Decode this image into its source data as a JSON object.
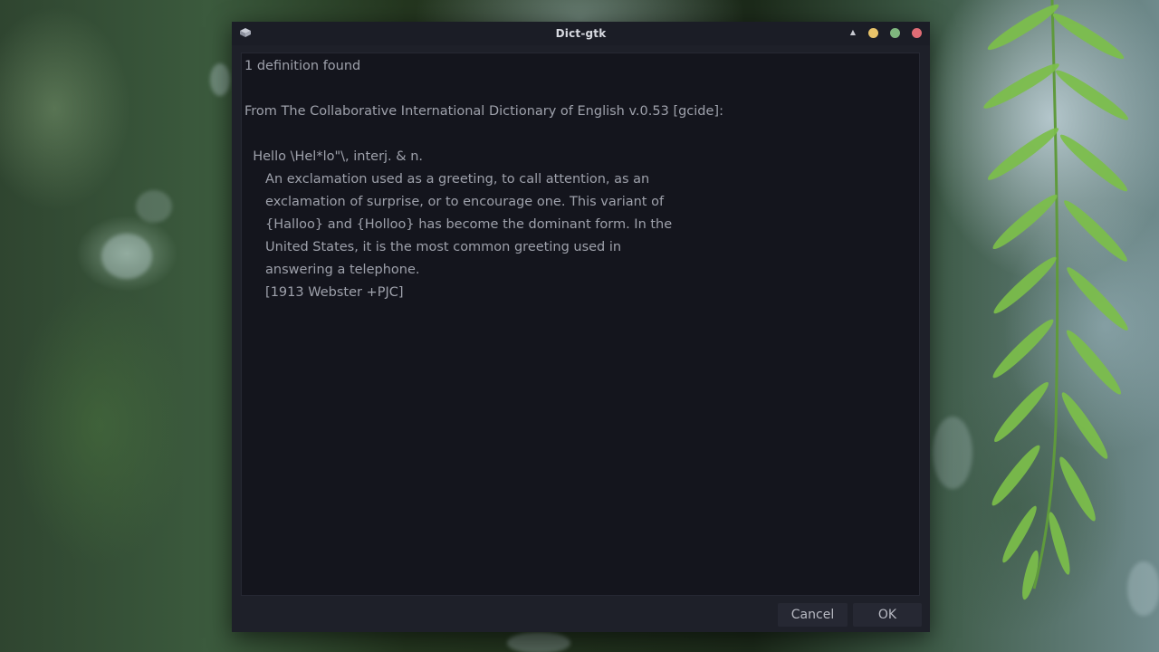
{
  "window": {
    "title": "Dict-gtk"
  },
  "titlebar": {
    "app_icon": "dictionary-icon",
    "shade_icon": "triangle-up-icon",
    "buttons": {
      "minimize_color": "#e9c46a",
      "maximize_color": "#7fb77e",
      "close_color": "#e06c75"
    }
  },
  "definition": {
    "lines": [
      "1 definition found",
      "",
      "From The Collaborative International Dictionary of English v.0.53 [gcide]:",
      "",
      "  Hello \\Hel*lo\"\\, interj. & n.",
      "     An exclamation used as a greeting, to call attention, as an",
      "     exclamation of surprise, or to encourage one. This variant of",
      "     {Halloo} and {Holloo} has become the dominant form. In the",
      "     United States, it is the most common greeting used in",
      "     answering a telephone.",
      "     [1913 Webster +PJC]"
    ]
  },
  "footer": {
    "cancel_label": "Cancel",
    "ok_label": "OK"
  }
}
